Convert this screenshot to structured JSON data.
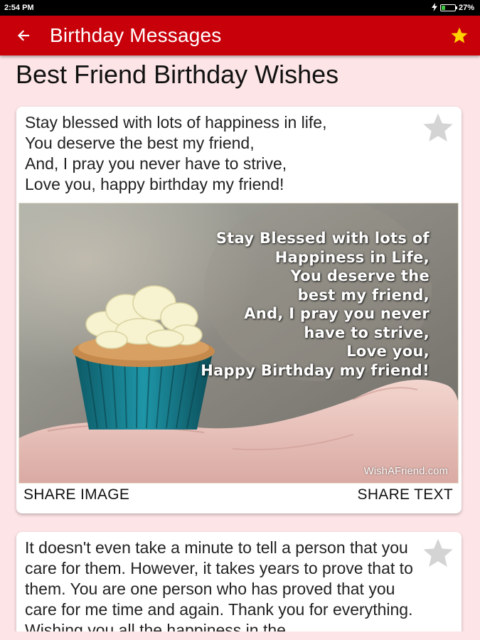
{
  "status_bar": {
    "time": "2:54 PM",
    "battery": "27%",
    "battery_level": 0.27
  },
  "app_bar": {
    "title": "Birthday Messages",
    "back_icon": "arrow-left-icon",
    "action_icon": "star-icon",
    "accent": "#c8000a",
    "star_color": "#ffd200"
  },
  "page": {
    "title": "Best Friend Birthday Wishes",
    "background": "#fde4e6"
  },
  "cards": [
    {
      "text": "Stay blessed with lots of happiness in life,\nYou deserve the best my friend,\nAnd, I pray you never have to strive,\nLove you, happy birthday my friend!",
      "image_text": "Stay Blessed with lots of\nHappiness in Life,\nYou deserve the\nbest my friend,\nAnd, I pray you never\nhave to strive,\nLove you,\nHappy Birthday my friend!",
      "image_watermark": "WishAFriend.com",
      "share_image_label": "SHARE IMAGE",
      "share_text_label": "SHARE TEXT"
    },
    {
      "text": "It doesn't even take a minute to tell a person that you care for them. However, it takes years to prove that to them. You are one person who has proved that you care for me time and again. Thank you for everything. Wishing you all the happiness in the"
    }
  ]
}
